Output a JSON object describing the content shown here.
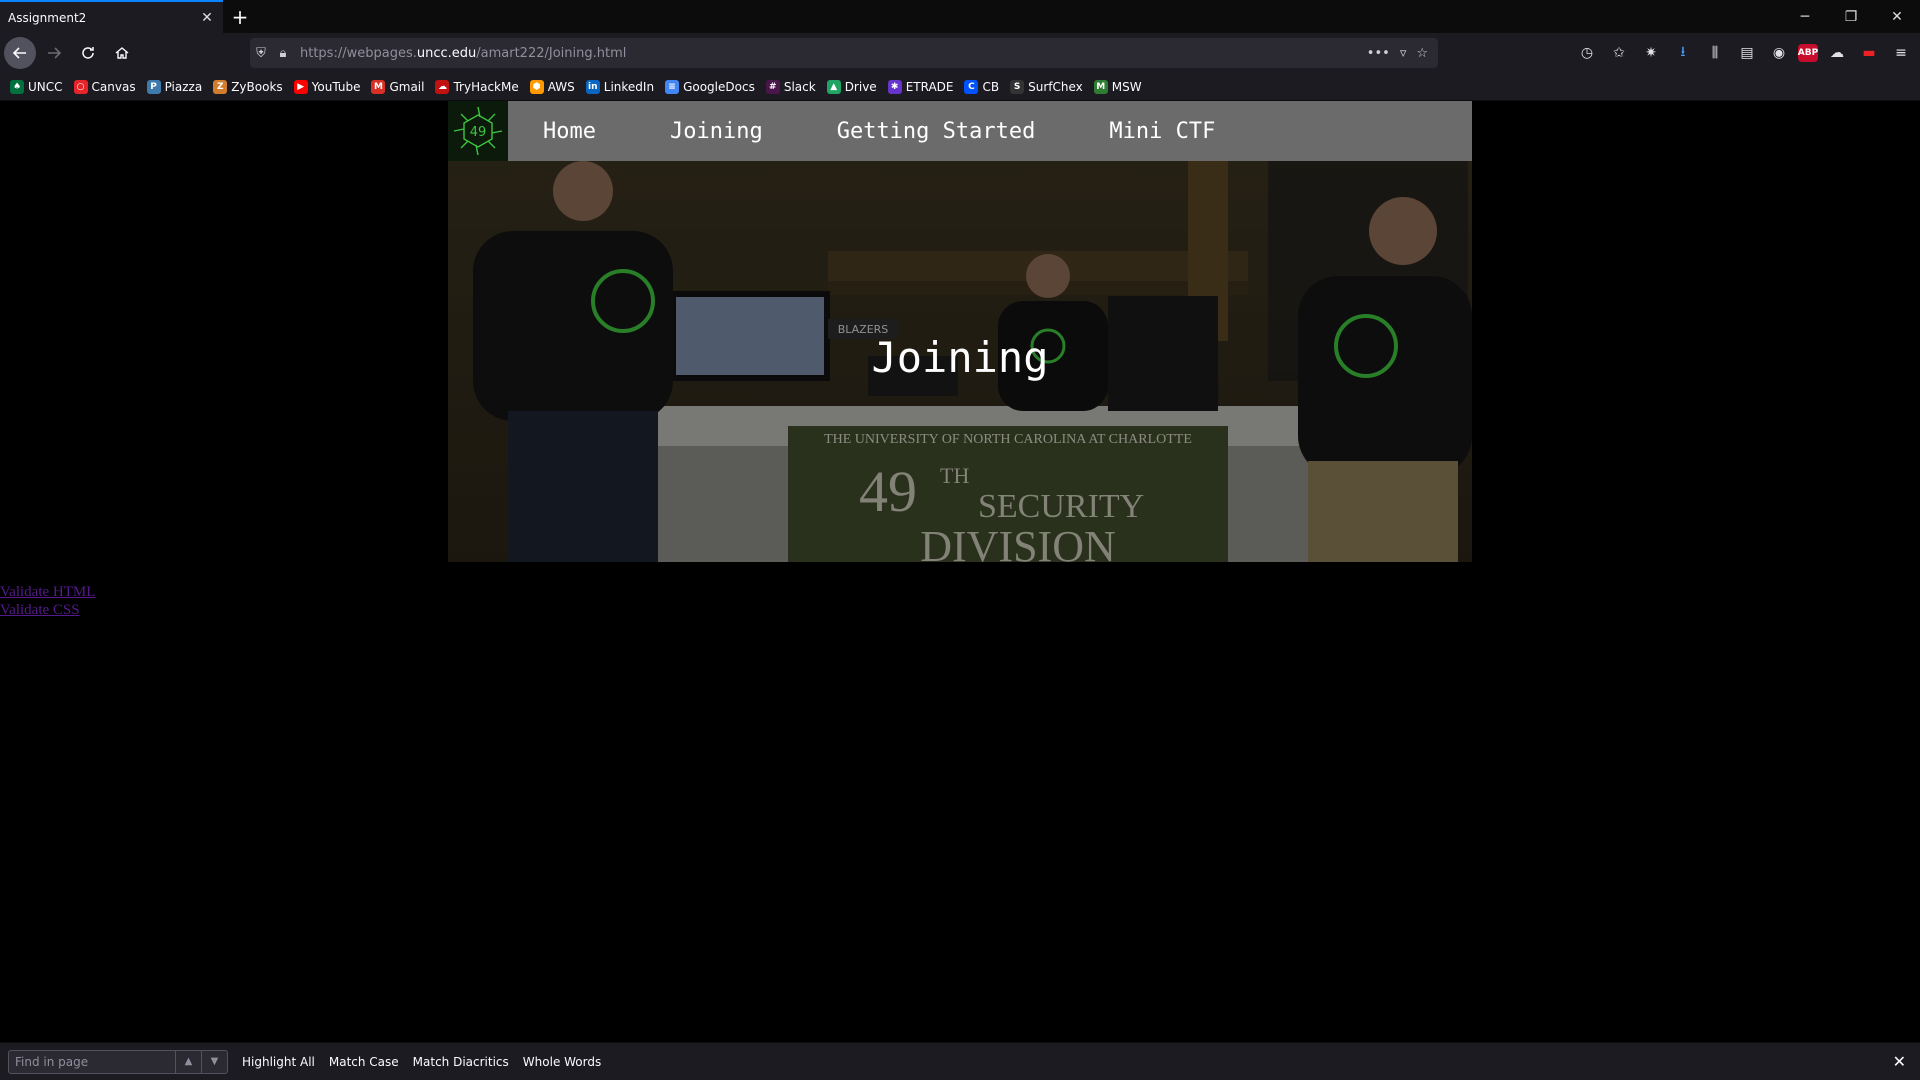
{
  "browser": {
    "tab_title": "Assignment2",
    "tab_close": "✕",
    "new_tab": "+",
    "url_prefix": "https://webpages.",
    "url_domain": "uncc.edu",
    "url_path": "/amart222/Joining.html",
    "window_controls": [
      "─",
      "❐",
      "✕"
    ]
  },
  "bookmarks": [
    {
      "label": "UNCC",
      "color": "#00703c",
      "glyph": "♠"
    },
    {
      "label": "Canvas",
      "color": "#e72429",
      "glyph": "○"
    },
    {
      "label": "Piazza",
      "color": "#3e7aab",
      "glyph": "P"
    },
    {
      "label": "ZyBooks",
      "color": "#d27d2d",
      "glyph": "Z"
    },
    {
      "label": "YouTube",
      "color": "#ff0000",
      "glyph": "▶"
    },
    {
      "label": "Gmail",
      "color": "#d93025",
      "glyph": "M"
    },
    {
      "label": "TryHackMe",
      "color": "#c11111",
      "glyph": "☁"
    },
    {
      "label": "AWS",
      "color": "#ff9900",
      "glyph": "⬢"
    },
    {
      "label": "LinkedIn",
      "color": "#0a66c2",
      "glyph": "in"
    },
    {
      "label": "GoogleDocs",
      "color": "#4285f4",
      "glyph": "≡"
    },
    {
      "label": "Slack",
      "color": "#4a154b",
      "glyph": "#"
    },
    {
      "label": "Drive",
      "color": "#1fa463",
      "glyph": "▲"
    },
    {
      "label": "ETRADE",
      "color": "#6633cc",
      "glyph": "✱"
    },
    {
      "label": "CB",
      "color": "#0052ff",
      "glyph": "C"
    },
    {
      "label": "SurfChex",
      "color": "#333333",
      "glyph": "S"
    },
    {
      "label": "MSW",
      "color": "#2e7d32",
      "glyph": "M"
    }
  ],
  "site": {
    "logo_text": "49",
    "nav": [
      "Home",
      "Joining",
      "Getting Started",
      "Mini CTF"
    ],
    "hero_title": "Joining",
    "banner_line1": "THE UNIVERSITY OF NORTH CAROLINA AT CHARLOTTE",
    "banner_num": "49",
    "banner_th": "TH",
    "banner_security": "SECURITY",
    "banner_division": "DIVISION",
    "sign_text": "BLAZERS",
    "validate_html": "Validate HTML",
    "validate_css": "Validate CSS"
  },
  "findbar": {
    "placeholder": "Find in page",
    "options": [
      "Highlight All",
      "Match Case",
      "Match Diacritics",
      "Whole Words"
    ],
    "close": "✕"
  },
  "colors": {
    "accent": "#0a84ff",
    "site_nav_bg": "#6b6b6b",
    "visited_link": "#551a8b",
    "shirt_green": "#3ec43e"
  }
}
